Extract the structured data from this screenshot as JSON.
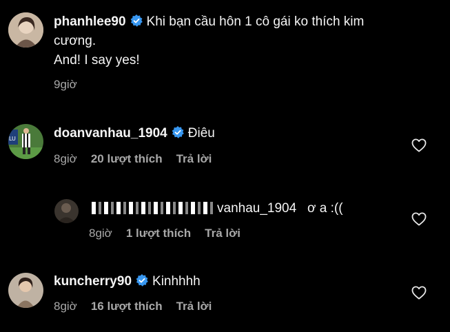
{
  "post": {
    "username": "phanhlee90",
    "caption_line1": "Khi bạn cầu hôn 1 cô gái ko thích kim",
    "caption_line2": "cương.",
    "caption_line3": "And! I say yes!",
    "time": "9giờ"
  },
  "comments": [
    {
      "username": "doanvanhau_1904",
      "text": "Điêu",
      "time": "8giờ",
      "likes": "20 lượt thích",
      "reply": "Trả lời"
    },
    {
      "username_visible": "vanhau_1904",
      "text": "ơ a :((",
      "time": "8giờ",
      "likes": "1 lượt thích",
      "reply": "Trả lời"
    },
    {
      "username": "kuncherry90",
      "text": "Kinhhhh",
      "time": "8giờ",
      "likes": "16 lượt thích",
      "reply": "Trả lời"
    }
  ],
  "colors": {
    "background": "#000000",
    "text": "#f5f5f5",
    "meta": "#a8a8a8",
    "verified": "#3897f0"
  },
  "icons": {
    "verified": "verified-badge-icon",
    "like": "heart-outline-icon"
  }
}
